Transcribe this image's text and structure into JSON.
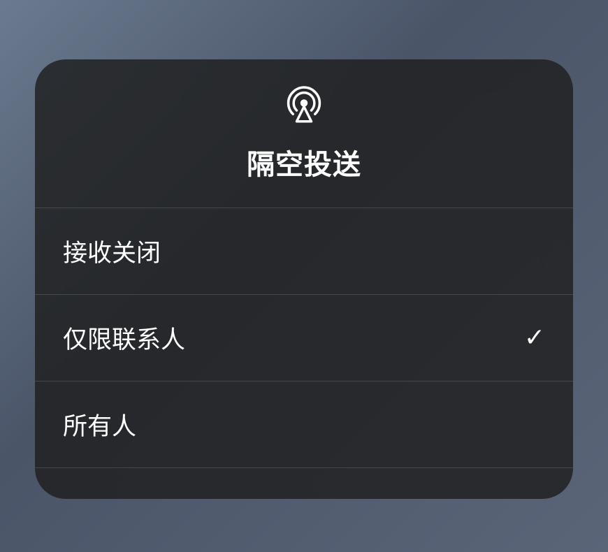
{
  "panel": {
    "title": "隔空投送",
    "options": [
      {
        "label": "接收关闭",
        "selected": false
      },
      {
        "label": "仅限联系人",
        "selected": true
      },
      {
        "label": "所有人",
        "selected": false
      }
    ]
  }
}
